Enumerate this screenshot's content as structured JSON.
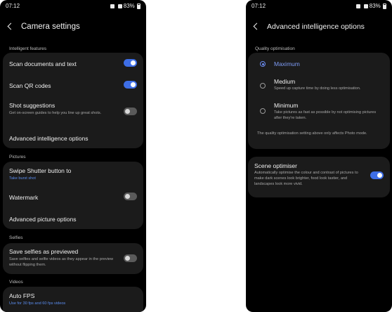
{
  "left_screen": {
    "status": {
      "time": "07:12",
      "battery": "83%"
    },
    "title": "Camera settings",
    "sections": {
      "intelligent": "Intelligent features",
      "pictures": "Pictures",
      "selfies": "Selfies",
      "videos": "Videos"
    },
    "rows": {
      "scan_documents": {
        "title": "Scan documents and text",
        "toggle": "on"
      },
      "scan_qr": {
        "title": "Scan QR codes",
        "toggle": "on"
      },
      "shot_suggestions": {
        "title": "Shot suggestions",
        "subtitle": "Get on-screen guides to help you line up great shots.",
        "toggle": "off"
      },
      "advanced_intelligence": {
        "title": "Advanced intelligence options"
      },
      "swipe_shutter": {
        "title": "Swipe Shutter button to",
        "subtitle": "Take burst shot"
      },
      "watermark": {
        "title": "Watermark",
        "toggle": "off"
      },
      "advanced_picture": {
        "title": "Advanced picture options"
      },
      "save_selfies": {
        "title": "Save selfies as previewed",
        "subtitle": "Save selfies and selfie videos as they appear in the preview without flipping them.",
        "toggle": "off"
      },
      "auto_fps": {
        "title": "Auto FPS",
        "subtitle": "Use for 30 fps and 60 fps videos"
      }
    }
  },
  "right_screen": {
    "status": {
      "time": "07:12",
      "battery": "83%"
    },
    "title": "Advanced intelligence options",
    "section": "Quality optimisation",
    "options": {
      "maximum": {
        "title": "Maximum",
        "selected": true
      },
      "medium": {
        "title": "Medium",
        "subtitle": "Speed up capture time by doing less optimisation.",
        "selected": false
      },
      "minimum": {
        "title": "Minimum",
        "subtitle": "Take pictures as fast as possible by not optimising pictures after they're taken.",
        "selected": false
      }
    },
    "note": "The quality optimisation setting above only affects Photo mode.",
    "scene_optimiser": {
      "title": "Scene optimiser",
      "subtitle": "Automatically optimise the colour and contrast of pictures to make dark scenes look brighter, food look tastier, and landscapes look more vivid.",
      "toggle": "on"
    }
  },
  "colors": {
    "accent": "#3e6ee6",
    "background": "#000000",
    "card": "#1b1b1b",
    "link": "#5b8def"
  }
}
